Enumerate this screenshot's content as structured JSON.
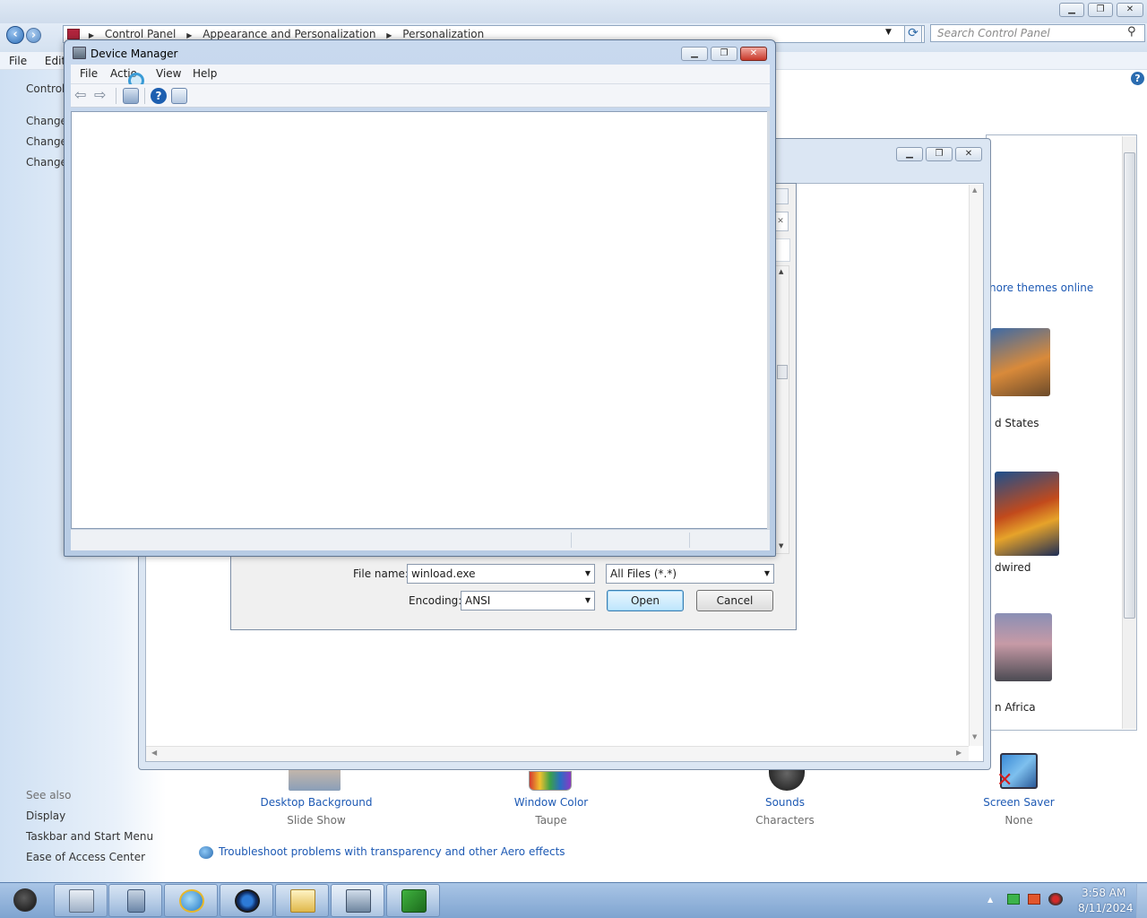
{
  "control_panel": {
    "breadcrumb": [
      "Control Panel",
      "Appearance and Personalization",
      "Personalization"
    ],
    "search_placeholder": "Search Control Panel",
    "menu": [
      "File",
      "Edit"
    ],
    "left_nav": {
      "home": "Control",
      "links": [
        "Change",
        "Change",
        "Change"
      ]
    },
    "see_also": {
      "heading": "See also",
      "links": [
        "Display",
        "Taskbar and Start Menu",
        "Ease of Access Center"
      ]
    },
    "themes": {
      "online_link": "nore themes online",
      "items": [
        "d States",
        "dwired",
        "n Africa"
      ]
    },
    "bottom_items": [
      {
        "label": "Desktop Background",
        "sub": "Slide Show",
        "icon": "desktop-background-icon"
      },
      {
        "label": "Window Color",
        "sub": "Taupe",
        "icon": "window-color-icon"
      },
      {
        "label": "Sounds",
        "sub": "Characters",
        "icon": "sounds-icon"
      },
      {
        "label": "Screen Saver",
        "sub": "None",
        "icon": "screen-saver-icon"
      }
    ],
    "troubleshoot": "Troubleshoot problems with transparency and other Aero effects"
  },
  "open_dialog": {
    "file_name_label": "File name:",
    "file_name_value": "winload.exe",
    "filter_value": "All Files  (*.*)",
    "encoding_label": "Encoding:",
    "encoding_value": "ANSI",
    "open_label": "Open",
    "cancel_label": "Cancel"
  },
  "device_manager": {
    "title": "Device Manager",
    "menu": [
      "File",
      "Actio",
      "View",
      "Help"
    ]
  },
  "taskbar": {
    "apps": [
      "start-orb",
      "file-manager-icon",
      "media-icon",
      "internet-explorer-icon",
      "windows-media-player-icon",
      "folder-explorer-icon",
      "device-manager-icon",
      "install-icon"
    ],
    "time": "3:58 AM",
    "date": "8/11/2024"
  },
  "colors": {
    "link": "#1e5ab4",
    "titlebar": "#c8d9ee",
    "taskbar": "#7fa4d0"
  }
}
